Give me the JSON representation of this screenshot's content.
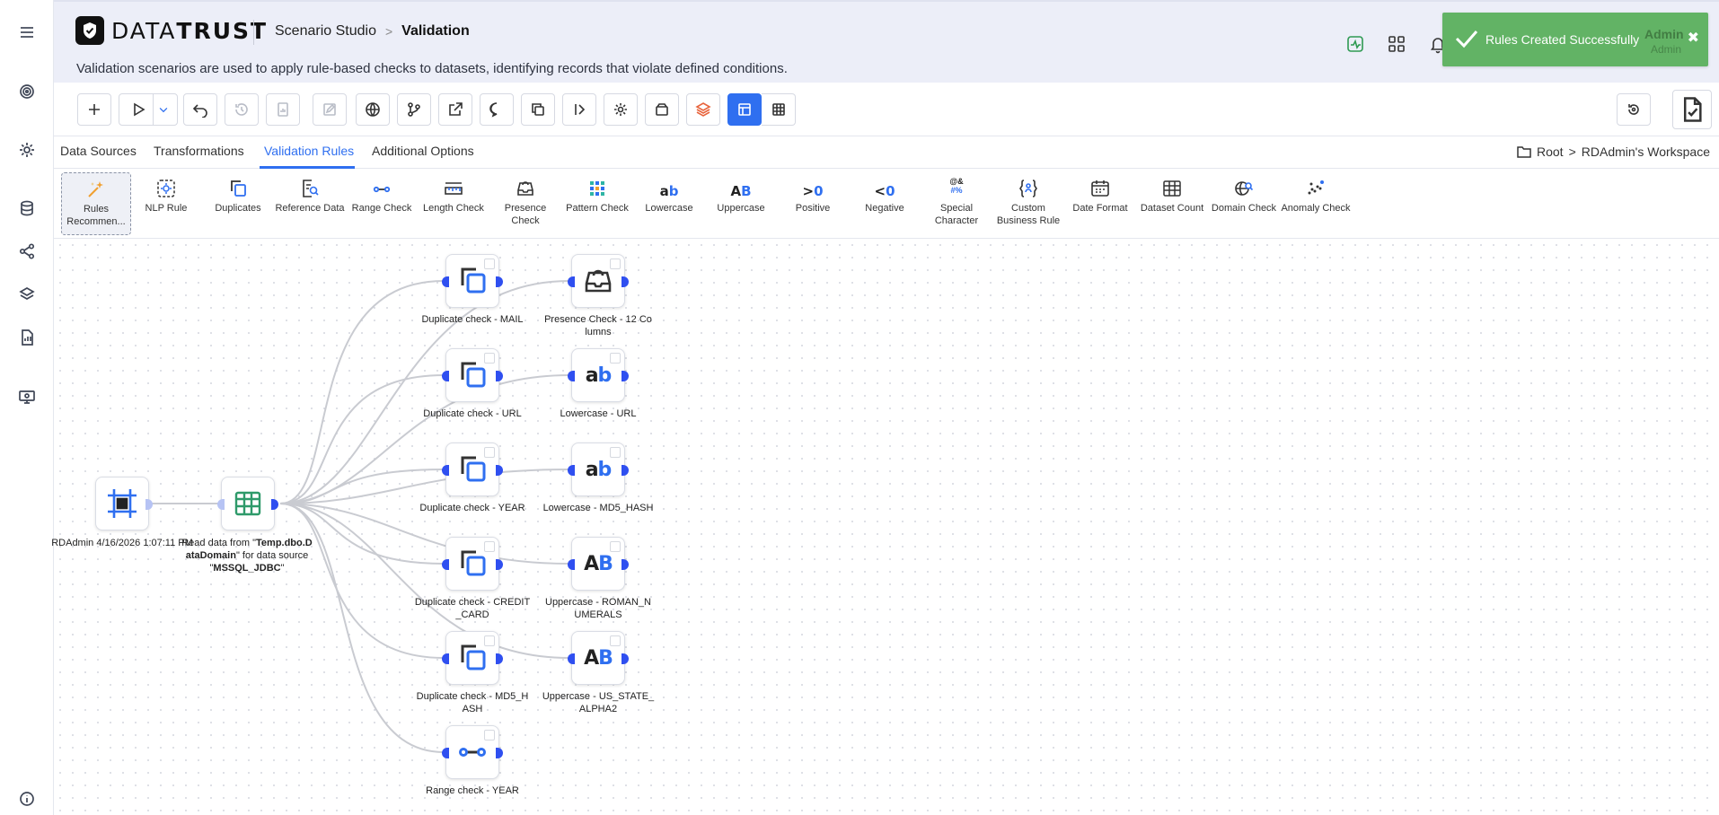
{
  "header": {
    "logo_text_light": "DATA",
    "logo_text_bold": "TRUST",
    "breadcrumb_parent": "Scenario Studio",
    "breadcrumb_current": "Validation",
    "description": "Validation scenarios are used to apply rule-based checks to datasets, identifying records that violate defined conditions.",
    "user_name": "Admin",
    "user_role": "Admin"
  },
  "toast": {
    "message": "Rules Created Successfully",
    "close_glyph": "✖"
  },
  "tabs": [
    {
      "label": "Data Sources"
    },
    {
      "label": "Transformations"
    },
    {
      "label": "Validation Rules"
    },
    {
      "label": "Additional Options"
    }
  ],
  "workspace": {
    "root": "Root",
    "separator": ">",
    "name": "RDAdmin's Workspace"
  },
  "palette": [
    {
      "label": "Rules Recommen..."
    },
    {
      "label": "NLP Rule"
    },
    {
      "label": "Duplicates"
    },
    {
      "label": "Reference Data"
    },
    {
      "label": "Range Check"
    },
    {
      "label": "Length Check"
    },
    {
      "label": "Presence Check"
    },
    {
      "label": "Pattern Check"
    },
    {
      "label": "Lowercase"
    },
    {
      "label": "Uppercase"
    },
    {
      "label": "Positive"
    },
    {
      "label": "Negative"
    },
    {
      "label": "Special Character"
    },
    {
      "label": "Custom Business Rule"
    },
    {
      "label": "Date Format"
    },
    {
      "label": "Dataset Count"
    },
    {
      "label": "Domain Check"
    },
    {
      "label": "Anomaly Check"
    }
  ],
  "glyphs": {
    "lowercase": [
      "a",
      "b"
    ],
    "uppercase": [
      "A",
      "B"
    ],
    "positive": [
      ">",
      "0"
    ],
    "negative": [
      "<",
      "0"
    ],
    "special_top": "@&",
    "special_bottom": "#%"
  },
  "nodes": {
    "source": {
      "label": "RDAdmin 4/16/2026 1:07:11 PM"
    },
    "read": {
      "label_prefix": "Read data from \"",
      "table": "Temp.dbo.DataDomain",
      "label_middle": "\" for data source \"",
      "datasource": "MSSQL_JDBC",
      "label_suffix": "\""
    },
    "dup_mail": {
      "label": "Duplicate check - MAIL"
    },
    "dup_url": {
      "label": "Duplicate check - URL"
    },
    "dup_year": {
      "label": "Duplicate check - YEAR"
    },
    "dup_cc": {
      "label": "Duplicate check - CREDIT_CARD"
    },
    "dup_md5": {
      "label": "Duplicate check - MD5_HASH"
    },
    "range_year": {
      "label": "Range check - YEAR"
    },
    "presence": {
      "label": "Presence Check - 12 Columns"
    },
    "lower_url": {
      "label": "Lowercase - URL"
    },
    "lower_md5": {
      "label": "Lowercase - MD5_HASH"
    },
    "upper_roman": {
      "label": "Uppercase - ROMAN_NUMERALS"
    },
    "upper_state": {
      "label": "Uppercase - US_STATE_ALPHA2"
    }
  },
  "colors": {
    "accent": "#2f6ff0",
    "toast": "#62b365",
    "header_bg": "#eceef8",
    "edge": "#c9cbd1",
    "port": "#2f4ff0"
  }
}
